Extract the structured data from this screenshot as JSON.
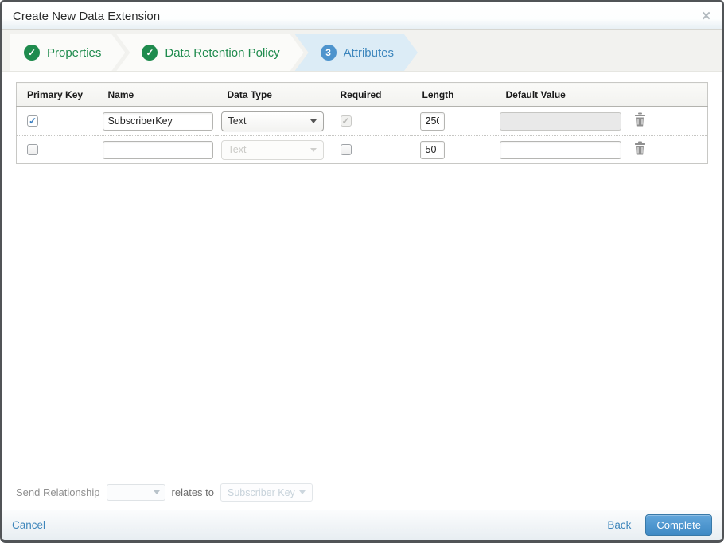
{
  "modal": {
    "title": "Create New Data Extension"
  },
  "icons": {
    "close": "✕",
    "check": "✓"
  },
  "wizard": {
    "steps": [
      {
        "label": "Properties",
        "status": "complete"
      },
      {
        "label": "Data Retention Policy",
        "status": "complete"
      },
      {
        "label": "Attributes",
        "status": "active",
        "number": "3"
      }
    ]
  },
  "attributes_table": {
    "columns": [
      "Primary Key",
      "Name",
      "Data Type",
      "Required",
      "Length",
      "Default Value",
      ""
    ],
    "rows": [
      {
        "primary_key": true,
        "name": "SubscriberKey",
        "data_type": "Text",
        "data_type_disabled": false,
        "required": true,
        "required_disabled": true,
        "length": "250",
        "default_value": "",
        "default_disabled": true
      },
      {
        "primary_key": false,
        "name": "",
        "data_type": "Text",
        "data_type_disabled": true,
        "required": false,
        "required_disabled": false,
        "length": "50",
        "default_value": "",
        "default_disabled": false
      }
    ]
  },
  "send_relationship": {
    "label": "Send Relationship",
    "relates_to_label": "relates to",
    "target_field": "Subscriber Key"
  },
  "footer": {
    "cancel_label": "Cancel",
    "back_label": "Back",
    "complete_label": "Complete"
  },
  "colors": {
    "step_complete_green": "#1f8b4e",
    "step_active_blue": "#3c86bd",
    "step_active_bg": "#dcecf6",
    "link_blue": "#3e86bb",
    "primary_button_blue": "#4089c6",
    "checkbox_check_blue": "#3a7fc1"
  }
}
